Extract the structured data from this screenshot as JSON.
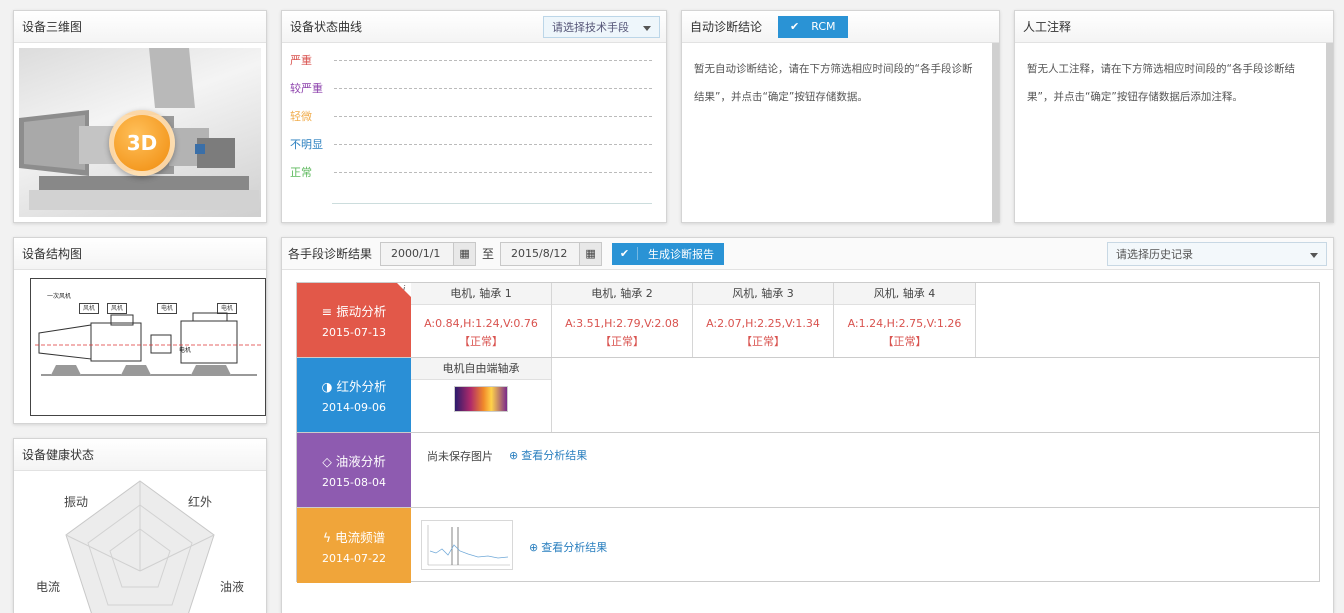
{
  "panels": {
    "three_d": {
      "title": "设备三维图",
      "badge": "3D"
    },
    "curve": {
      "title": "设备状态曲线",
      "select_placeholder": "请选择技术手段",
      "levels": [
        {
          "label": "严重",
          "color": "#d9534f"
        },
        {
          "label": "较严重",
          "color": "#8e44ad"
        },
        {
          "label": "轻微",
          "color": "#f0ad4e"
        },
        {
          "label": "不明显",
          "color": "#2a7fbf"
        },
        {
          "label": "正常",
          "color": "#5cb85c"
        }
      ]
    },
    "auto_diag": {
      "title": "自动诊断结论",
      "rcm_label": "RCM",
      "text": "暂无自动诊断结论，请在下方筛选相应时间段的“各手段诊断结果”，并点击“确定”按钮存储数据。"
    },
    "manual_note": {
      "title": "人工注释",
      "text": "暂无人工注释，请在下方筛选相应时间段的“各手段诊断结果”，并点击“确定”按钮存储数据后添加注释。"
    },
    "structure": {
      "title": "设备结构图",
      "diagram_title": "一次风机",
      "tags": [
        "风机",
        "风机",
        "电机",
        "电机"
      ],
      "motor_label": "电机"
    },
    "health": {
      "title": "设备健康状态",
      "axes": [
        "振动",
        "红外",
        "油液",
        "电流"
      ]
    }
  },
  "main": {
    "title": "各手段诊断结果",
    "start_date": "2000/1/1",
    "to_label": "至",
    "end_date": "2015/8/12",
    "generate_label": "生成诊断报告",
    "history_placeholder": "请选择历史记录",
    "rows": [
      {
        "name": "振动分析",
        "date": "2015-07-13",
        "icon": "≡",
        "color": "#e25849",
        "cells": [
          {
            "head": "电机, 轴承 1",
            "value": "A:0.84,H:1.24,V:0.76",
            "status": "【正常】"
          },
          {
            "head": "电机, 轴承 2",
            "value": "A:3.51,H:2.79,V:2.08",
            "status": "【正常】"
          },
          {
            "head": "风机, 轴承 3",
            "value": "A:2.07,H:2.25,V:1.34",
            "status": "【正常】"
          },
          {
            "head": "风机, 轴承 4",
            "value": "A:1.24,H:2.75,V:1.26",
            "status": "【正常】"
          }
        ]
      },
      {
        "name": "红外分析",
        "date": "2014-09-06",
        "icon": "◑",
        "color": "#2a8fd6",
        "cell_head": "电机自由端轴承"
      },
      {
        "name": "油液分析",
        "date": "2015-08-04",
        "icon": "◇",
        "color": "#8e5bb0",
        "no_image": "尚未保存图片",
        "link": "查看分析结果"
      },
      {
        "name": "电流频谱",
        "date": "2014-07-22",
        "icon": "ϟ",
        "color": "#f0a53a",
        "link": "查看分析结果"
      }
    ]
  }
}
